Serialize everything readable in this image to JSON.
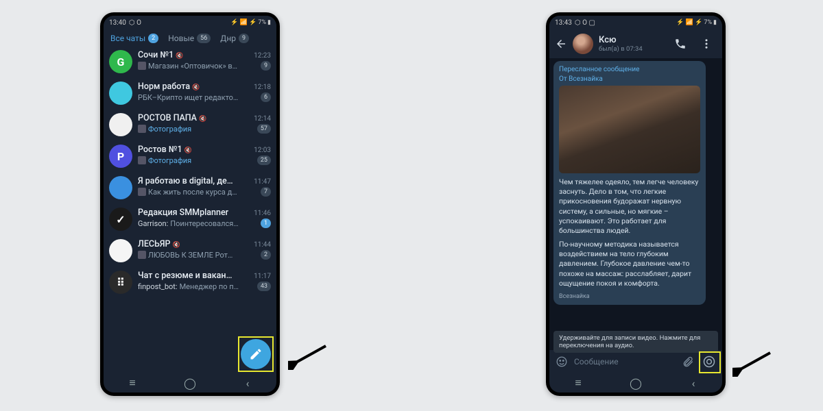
{
  "left": {
    "statusbar": {
      "time": "13:40",
      "indicator": "⬡ O",
      "icons": "⚡ 📶 ⚡",
      "battery": "7%"
    },
    "tabs": [
      {
        "label": "Все чаты",
        "badge": "2",
        "active": true
      },
      {
        "label": "Новые",
        "badge": "56",
        "active": false
      },
      {
        "label": "Днр",
        "badge": "9",
        "active": false
      }
    ],
    "chats": [
      {
        "name": "Сочи №1",
        "muted": true,
        "time": "12:23",
        "preview": "Магазин «Оптовичок» в…",
        "thumb": true,
        "unread": "9",
        "avatar_bg": "#2fb84c",
        "avatar_txt": "G"
      },
      {
        "name": "Норм работа",
        "muted": true,
        "time": "12:18",
        "preview": "РБК–Крипто ищет редакто…",
        "thumb": false,
        "unread": "6",
        "avatar_bg": "#3fc8e0",
        "avatar_txt": ""
      },
      {
        "name": "РОСТОВ ПАПА",
        "muted": true,
        "time": "12:14",
        "preview": "Фотография",
        "preview_color": "#5fb0e8",
        "thumb": true,
        "unread": "57",
        "avatar_bg": "#f0f0f0",
        "avatar_txt": ""
      },
      {
        "name": "Ростов №1",
        "muted": true,
        "time": "12:03",
        "preview": "Фотография",
        "preview_color": "#5fb0e8",
        "thumb": true,
        "unread": "25",
        "avatar_bg": "#5050e0",
        "avatar_txt": "P"
      },
      {
        "name": "Я работаю в digital, дет…",
        "muted": true,
        "time": "11:47",
        "preview": "Как жить после курса д…",
        "thumb": true,
        "unread": "7",
        "avatar_bg": "#3a90e0",
        "avatar_txt": ""
      },
      {
        "name": "Редакция SMMplanner",
        "muted": false,
        "time": "11:46",
        "preview_prefix": "Garrison:",
        "preview": " Поинтересовался…",
        "thumb": false,
        "unread": "1",
        "unread_blue": true,
        "avatar_bg": "#1a1a1a",
        "avatar_txt": "✓"
      },
      {
        "name": "ЛЕСЬЯР",
        "muted": true,
        "time": "11:44",
        "preview": "ЛЮБОВЬ К ЗЕМЛЕ  Рот…",
        "thumb": true,
        "unread": "2",
        "avatar_bg": "#f5f5f5",
        "avatar_txt": ""
      },
      {
        "name": "Чат с резюме и ваканси…",
        "muted": true,
        "time": "11:17",
        "preview_prefix": "finpost_bot:",
        "preview": " Менеджер по п…",
        "thumb": false,
        "unread": "43",
        "avatar_bg": "#2a2a2a",
        "avatar_txt": "⠿"
      }
    ]
  },
  "right": {
    "statusbar": {
      "time": "13:43",
      "indicator": "⬡ O ▢",
      "icons": "⚡ 📶 ⚡",
      "battery": "7%"
    },
    "header": {
      "name": "Ксю",
      "status": "был(а) в 07:34"
    },
    "message": {
      "fwd_label": "Пересланное сообщение",
      "fwd_from": "От Всезнайка",
      "p1": "Чем тяжелее одеяло, тем легче человеку заснуть. Дело в том, что легкие прикосновения будоражат нервную систему, а сильные, но мягкие – успокаивают. Это работает для большинства людей.",
      "p2": "По-научному методика называется воздействием на тело глубоким давлением. Глубокое давление чем-то похоже на массаж: расслабляет, дарит ощущение покоя и комфорта.",
      "sig": "Всезнайка"
    },
    "tooltip": "Удерживайте для записи видео. Нажмите для переключения на аудио.",
    "input_placeholder": "Сообщение"
  }
}
